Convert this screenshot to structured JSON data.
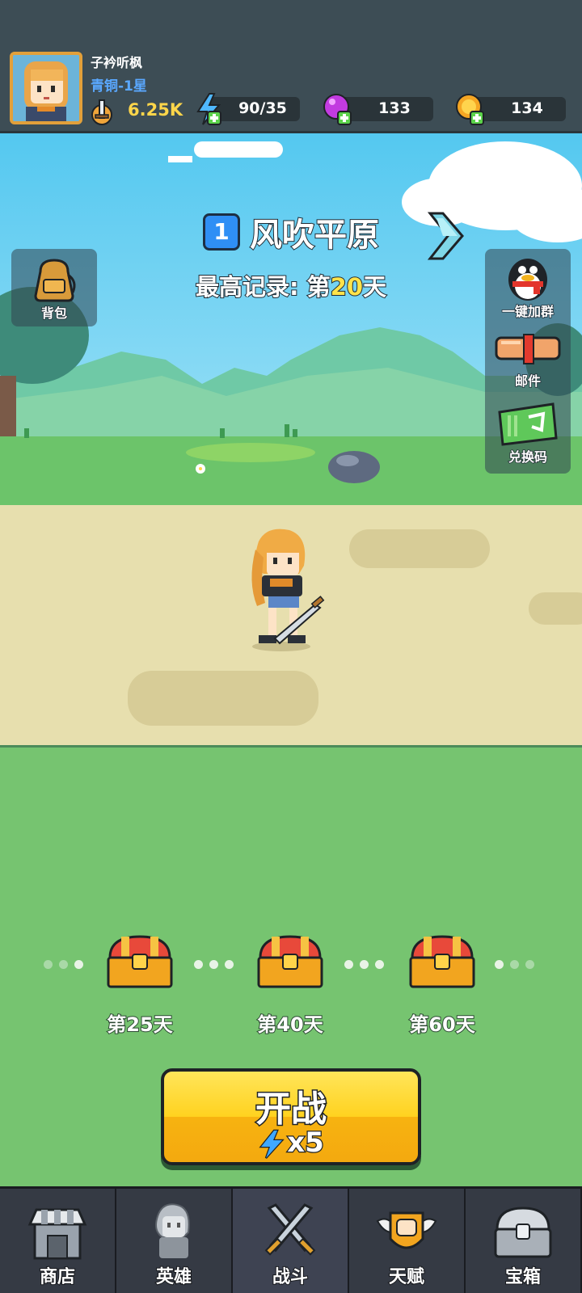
{
  "player": {
    "name": "子衿听枫",
    "rank": "青铜-1星",
    "power": "6.25K"
  },
  "resources": {
    "energy": "90/35",
    "gems": "133",
    "coins": "134"
  },
  "stage": {
    "number": "1",
    "name": "风吹平原",
    "record_prefix": "最高记录: 第",
    "record_days": "20",
    "record_suffix": "天"
  },
  "side_buttons": {
    "bag": "背包",
    "join_group": "一键加群",
    "mail": "邮件",
    "redeem": "兑换码"
  },
  "rewards": [
    {
      "label": "第25天",
      "icon": "treasure-chest-icon"
    },
    {
      "label": "第40天",
      "icon": "treasure-chest-icon"
    },
    {
      "label": "第60天",
      "icon": "treasure-chest-icon"
    }
  ],
  "fight_button": {
    "label": "开战",
    "cost": "x5"
  },
  "nav": {
    "items": [
      {
        "label": "商店",
        "icon": "shop-icon"
      },
      {
        "label": "英雄",
        "icon": "hero-icon"
      },
      {
        "label": "战斗",
        "icon": "crossed-swords-icon"
      },
      {
        "label": "天赋",
        "icon": "talent-fist-icon"
      },
      {
        "label": "宝箱",
        "icon": "silver-chest-icon"
      }
    ],
    "active": "战斗"
  },
  "colors": {
    "topbar": "#3d4d55",
    "accent_gold": "#ffd21f",
    "rank_blue": "#5aa8ff",
    "record_yellow": "#ffe34a",
    "grass": "#76c470",
    "road": "#e7dfae"
  }
}
